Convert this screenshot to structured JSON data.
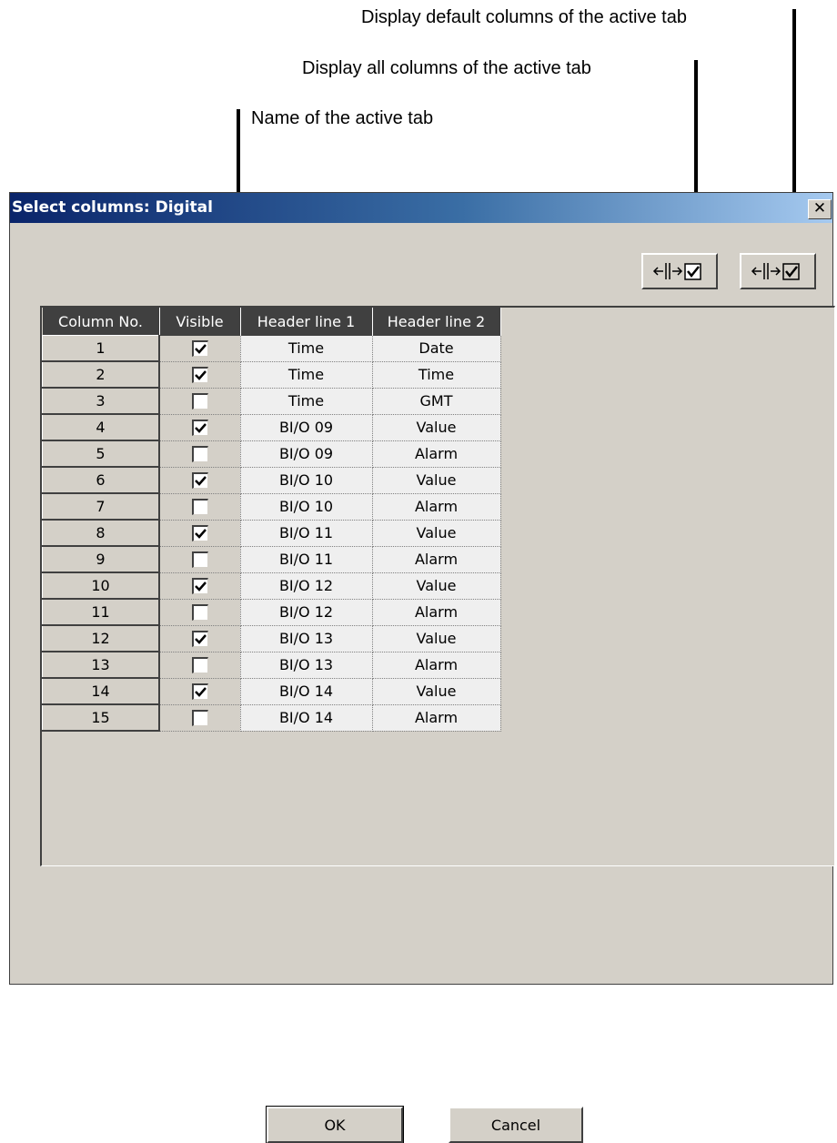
{
  "annotations": {
    "default_columns": "Display default columns of the active tab",
    "all_columns": "Display all columns of the active tab",
    "tab_name": "Name of the active tab"
  },
  "dialog": {
    "title": "Select columns: Digital",
    "close_glyph": "✕",
    "ok_label": "OK",
    "cancel_label": "Cancel"
  },
  "toolbar": {
    "show_all_icon": "columns-check-icon",
    "show_default_icon": "columns-check-icon"
  },
  "table": {
    "headers": [
      "Column No.",
      "Visible",
      "Header line 1",
      "Header line 2"
    ],
    "rows": [
      {
        "no": "1",
        "visible": true,
        "h1": "Time",
        "h2": "Date"
      },
      {
        "no": "2",
        "visible": true,
        "h1": "Time",
        "h2": "Time"
      },
      {
        "no": "3",
        "visible": false,
        "h1": "Time",
        "h2": "GMT"
      },
      {
        "no": "4",
        "visible": true,
        "h1": "BI/O 09",
        "h2": "Value"
      },
      {
        "no": "5",
        "visible": false,
        "h1": "BI/O 09",
        "h2": "Alarm"
      },
      {
        "no": "6",
        "visible": true,
        "h1": "BI/O 10",
        "h2": "Value"
      },
      {
        "no": "7",
        "visible": false,
        "h1": "BI/O 10",
        "h2": "Alarm"
      },
      {
        "no": "8",
        "visible": true,
        "h1": "BI/O 11",
        "h2": "Value"
      },
      {
        "no": "9",
        "visible": false,
        "h1": "BI/O 11",
        "h2": "Alarm"
      },
      {
        "no": "10",
        "visible": true,
        "h1": "BI/O 12",
        "h2": "Value"
      },
      {
        "no": "11",
        "visible": false,
        "h1": "BI/O 12",
        "h2": "Alarm"
      },
      {
        "no": "12",
        "visible": true,
        "h1": "BI/O 13",
        "h2": "Value"
      },
      {
        "no": "13",
        "visible": false,
        "h1": "BI/O 13",
        "h2": "Alarm"
      },
      {
        "no": "14",
        "visible": true,
        "h1": "BI/O 14",
        "h2": "Value"
      },
      {
        "no": "15",
        "visible": false,
        "h1": "BI/O 14",
        "h2": "Alarm"
      }
    ]
  }
}
